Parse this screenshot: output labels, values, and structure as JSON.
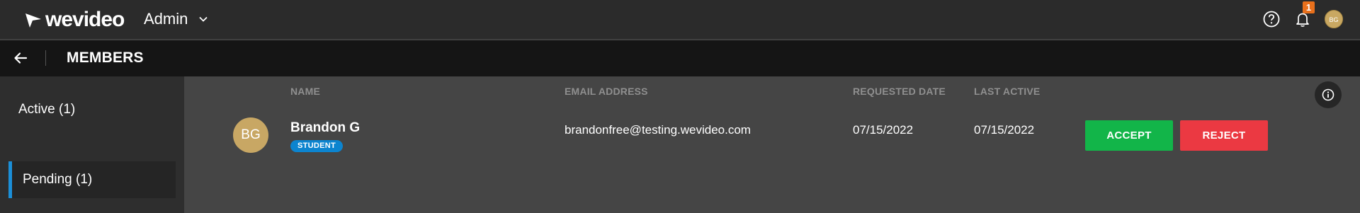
{
  "topbar": {
    "logo_text": "wevideo",
    "workspace_label": "Admin",
    "notification_count": "1",
    "user_initials": "BG",
    "icons": {
      "logo": "wevideo-logo-icon",
      "chevron": "chevron-down-icon",
      "help": "help-icon",
      "bell": "bell-icon"
    }
  },
  "subheader": {
    "title": "MEMBERS",
    "back_icon": "arrow-left-icon"
  },
  "sidebar": {
    "items": [
      {
        "label": "Active (1)",
        "selected": false
      },
      {
        "label": "Pending (1)",
        "selected": true
      }
    ],
    "accent_color": "#1b8fd8"
  },
  "table": {
    "columns": [
      "NAME",
      "EMAIL ADDRESS",
      "REQUESTED DATE",
      "LAST ACTIVE"
    ],
    "rows": [
      {
        "initials": "BG",
        "name": "Brandon G",
        "role": "STUDENT",
        "email": "brandonfree@testing.wevideo.com",
        "requested_date": "07/15/2022",
        "last_active": "07/15/2022",
        "accept_label": "ACCEPT",
        "reject_label": "REJECT"
      }
    ]
  },
  "colors": {
    "accept": "#12b549",
    "reject": "#eb3942",
    "badge": "#0c84cf",
    "notification": "#e8701c",
    "avatar": "#c8a764"
  }
}
